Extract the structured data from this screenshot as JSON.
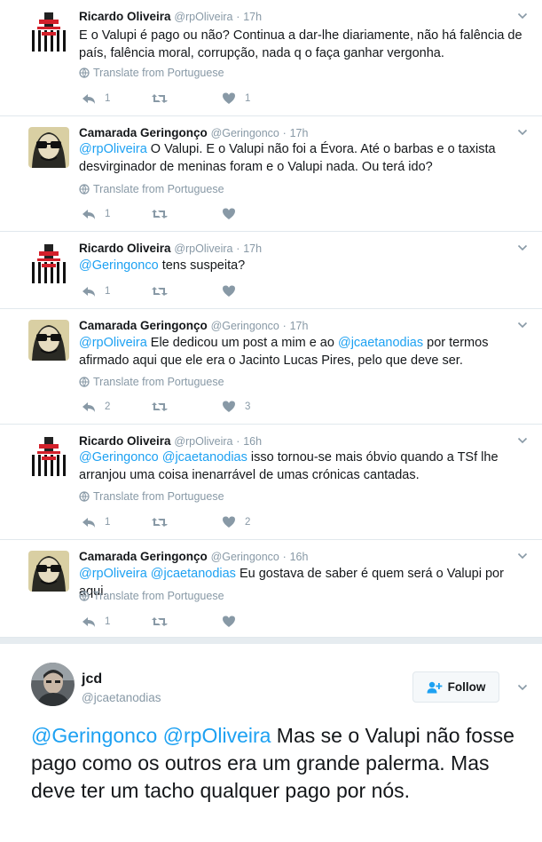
{
  "colors": {
    "accent": "#1da1f2",
    "muted": "#8899a6",
    "border": "#e1e8ed",
    "divider_band": "#e6ecf0"
  },
  "icons": [
    "reply-icon",
    "retweet-icon",
    "like-icon",
    "globe-icon",
    "chevron-down-icon",
    "add-user-icon"
  ],
  "replies": [
    {
      "name": "Ricardo Oliveira",
      "handle": "@rpOliveira",
      "sep": "·",
      "time": "17h",
      "avatar": "striped",
      "segments": [
        {
          "t": "E o Valupi é pago ou não? Continua a dar-lhe diariamente, não há falência de país, falência moral, corrupção, nada q o faça ganhar vergonha.",
          "m": false
        }
      ],
      "translate": "Translate from Portuguese",
      "reply_count": "1",
      "retweet_count": "",
      "like_count": "1"
    },
    {
      "name": "Camarada Geringonço",
      "handle": "@Geringonco",
      "sep": "·",
      "time": "17h",
      "avatar": "sunglasses",
      "segments": [
        {
          "t": "@rpOliveira",
          "m": true
        },
        {
          "t": " O Valupi. E o Valupi não foi a Évora. Até o barbas e o taxista desvirginador de meninas foram e o Valupi nada. Ou terá ido?",
          "m": false
        }
      ],
      "translate": "Translate from Portuguese",
      "reply_count": "1",
      "retweet_count": "",
      "like_count": ""
    },
    {
      "name": "Ricardo Oliveira",
      "handle": "@rpOliveira",
      "sep": "·",
      "time": "17h",
      "avatar": "striped",
      "segments": [
        {
          "t": "@Geringonco",
          "m": true
        },
        {
          "t": " tens suspeita?",
          "m": false
        }
      ],
      "translate": "",
      "reply_count": "1",
      "retweet_count": "",
      "like_count": ""
    },
    {
      "name": "Camarada Geringonço",
      "handle": "@Geringonco",
      "sep": "·",
      "time": "17h",
      "avatar": "sunglasses",
      "segments": [
        {
          "t": "@rpOliveira",
          "m": true
        },
        {
          "t": " Ele dedicou um post a mim e ao ",
          "m": false
        },
        {
          "t": "@jcaetanodias",
          "m": true
        },
        {
          "t": " por termos afirmado aqui que ele era o Jacinto Lucas Pires, pelo que deve ser.",
          "m": false
        }
      ],
      "translate": "Translate from Portuguese",
      "reply_count": "2",
      "retweet_count": "",
      "like_count": "3"
    },
    {
      "name": "Ricardo Oliveira",
      "handle": "@rpOliveira",
      "sep": "·",
      "time": "16h",
      "avatar": "striped",
      "segments": [
        {
          "t": "@Geringonco",
          "m": true
        },
        {
          "t": " ",
          "m": false
        },
        {
          "t": "@jcaetanodias",
          "m": true
        },
        {
          "t": " isso tornou-se mais óbvio quando a TSf lhe arranjou uma coisa inenarrável de umas crónicas cantadas.",
          "m": false
        }
      ],
      "translate": "Translate from Portuguese",
      "reply_count": "1",
      "retweet_count": "",
      "like_count": "2"
    },
    {
      "name": "Camarada Geringonço",
      "handle": "@Geringonco",
      "sep": "·",
      "time": "16h",
      "avatar": "sunglasses",
      "segments": [
        {
          "t": "@rpOliveira",
          "m": true
        },
        {
          "t": " ",
          "m": false
        },
        {
          "t": "@jcaetanodias",
          "m": true
        },
        {
          "t": " Eu gostava de saber é quem será o Valupi por aqui.",
          "m": false
        }
      ],
      "translate": "Translate from Portuguese",
      "reply_count": "1",
      "retweet_count": "",
      "like_count": ""
    }
  ],
  "main": {
    "name": "jcd",
    "handle": "@jcaetanodias",
    "follow_label": "Follow",
    "segments": [
      {
        "t": "@Geringonco",
        "m": true
      },
      {
        "t": " ",
        "m": false
      },
      {
        "t": "@rpOliveira",
        "m": true
      },
      {
        "t": " Mas se o Valupi não fosse pago como os outros era um grande palerma. Mas deve ter um tacho qualquer pago por nós.",
        "m": false
      }
    ]
  }
}
